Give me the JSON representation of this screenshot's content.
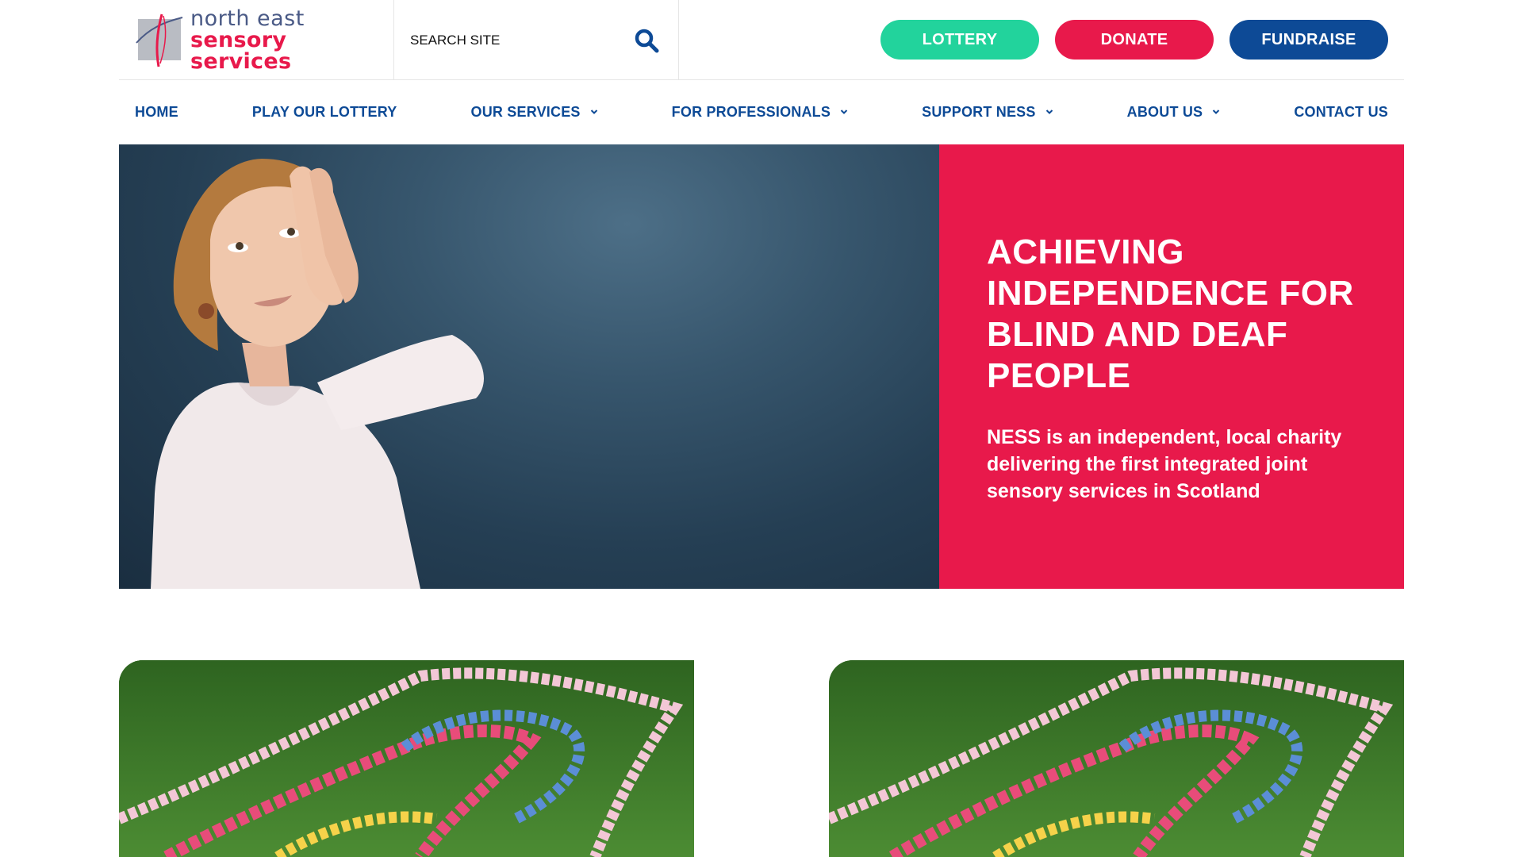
{
  "brand": {
    "line1": "north east",
    "line2": "sensory services",
    "colors": {
      "navy": "#0d4a96",
      "pink": "#e8194b",
      "green": "#22d39c",
      "slate": "#4a5a86"
    }
  },
  "search": {
    "placeholder": "SEARCH SITE",
    "icon": "search-icon"
  },
  "cta": {
    "lottery": "LOTTERY",
    "donate": "DONATE",
    "fundraise": "FUNDRAISE"
  },
  "nav": {
    "items": [
      {
        "label": "HOME",
        "has_dropdown": false
      },
      {
        "label": "PLAY OUR LOTTERY",
        "has_dropdown": false
      },
      {
        "label": "OUR SERVICES",
        "has_dropdown": true
      },
      {
        "label": "FOR PROFESSIONALS",
        "has_dropdown": true
      },
      {
        "label": "SUPPORT NESS",
        "has_dropdown": true
      },
      {
        "label": "ABOUT US",
        "has_dropdown": true
      },
      {
        "label": "CONTACT US",
        "has_dropdown": false
      }
    ]
  },
  "hero": {
    "title": "ACHIEVING INDEPENDENCE FOR BLIND AND DEAF PEOPLE",
    "subtitle": "NESS is an independent, local charity delivering the first integrated joint sensory services in Scotland"
  }
}
